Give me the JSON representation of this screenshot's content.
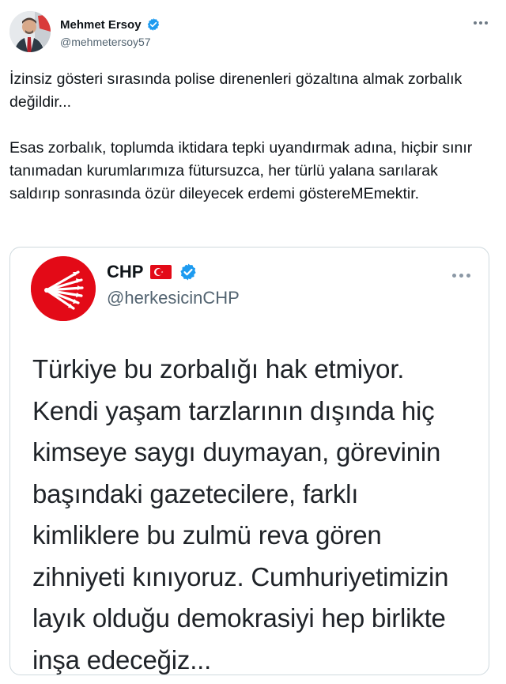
{
  "tweet": {
    "author": {
      "name": "Mehmet Ersoy",
      "handle": "@mehmetersoy57",
      "verified": true
    },
    "paragraphs": [
      "İzinsiz gösteri sırasında polise direnenleri gözaltına almak zorbalık değildir...",
      "Esas zorbalık, toplumda iktidara tepki uyandırmak adına, hiçbir sınır tanımadan kurumlarımıza fütursuzca, her türlü yalana sarılarak saldırıp sonrasında özür dileyecek erdemi göstereMEmektir."
    ]
  },
  "quoted_tweet": {
    "author": {
      "name": "CHP",
      "handle": "@herkesicinCHP",
      "verified": true,
      "flag": "turkey-flag-icon"
    },
    "lines": [
      "Türkiye bu zorbalığı hak etmiyor.",
      "Kendi yaşam tarzlarının dışında hiç",
      "kimseye saygı duymayan, görevinin",
      "başındaki gazetecilere, farklı",
      "kimliklere bu zulmü reva gören",
      "zihniyeti kınıyoruz. Cumhuriyetimizin",
      "layık olduğu demokrasiyi hep birlikte",
      "inşa edeceğiz..."
    ]
  },
  "colors": {
    "verified_blue": "#1d9bf0",
    "chp_red": "#e30a17",
    "secondary_text": "#536471",
    "border": "#cfd9de"
  }
}
